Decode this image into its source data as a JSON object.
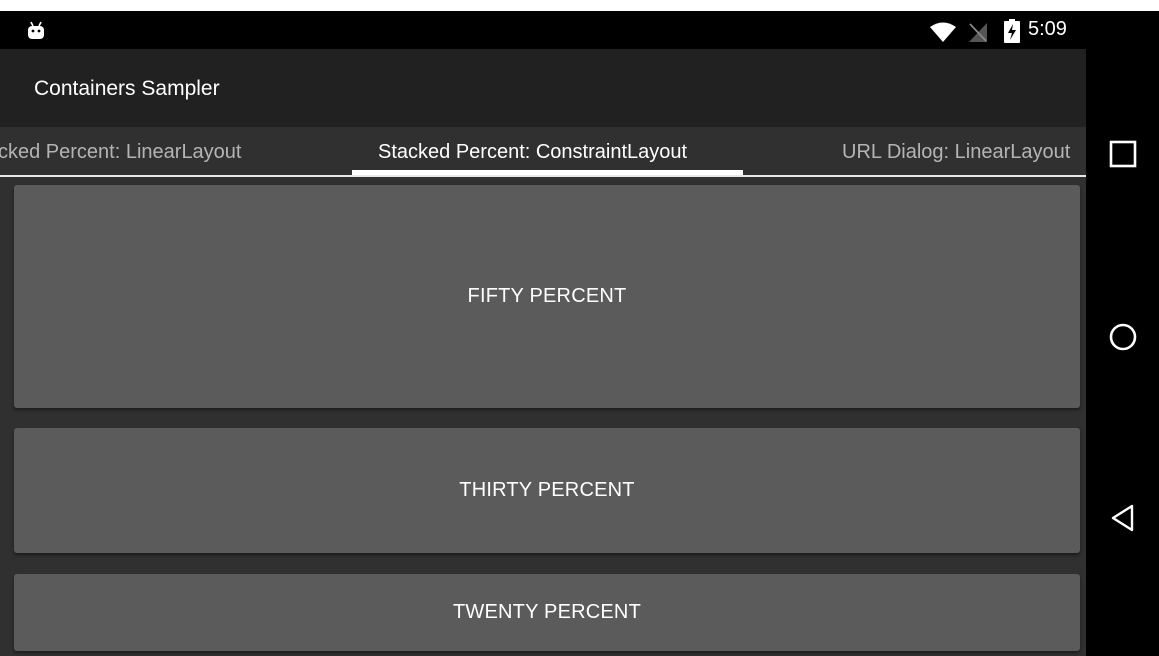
{
  "status_bar": {
    "time": "5:09",
    "icons": [
      "android-icon",
      "wifi-icon",
      "no-signal-icon",
      "battery-charging-icon"
    ]
  },
  "app_bar": {
    "title": "Containers Sampler"
  },
  "tabs": [
    {
      "label": "cked Percent: LinearLayout",
      "active": false
    },
    {
      "label": "Stacked Percent: ConstraintLayout",
      "active": true
    },
    {
      "label": "URL Dialog: LinearLayout",
      "active": false
    }
  ],
  "buttons": {
    "fifty": "FIFTY PERCENT",
    "thirty": "THIRTY PERCENT",
    "twenty": "TWENTY PERCENT"
  },
  "nav_bar": {
    "icons": [
      "recent-apps-icon",
      "home-icon",
      "back-icon"
    ]
  },
  "colors": {
    "status_bar": "#000000",
    "app_bar": "#212121",
    "background": "#303030",
    "button": "#5b5b5c",
    "tab_indicator": "#ffffff"
  }
}
